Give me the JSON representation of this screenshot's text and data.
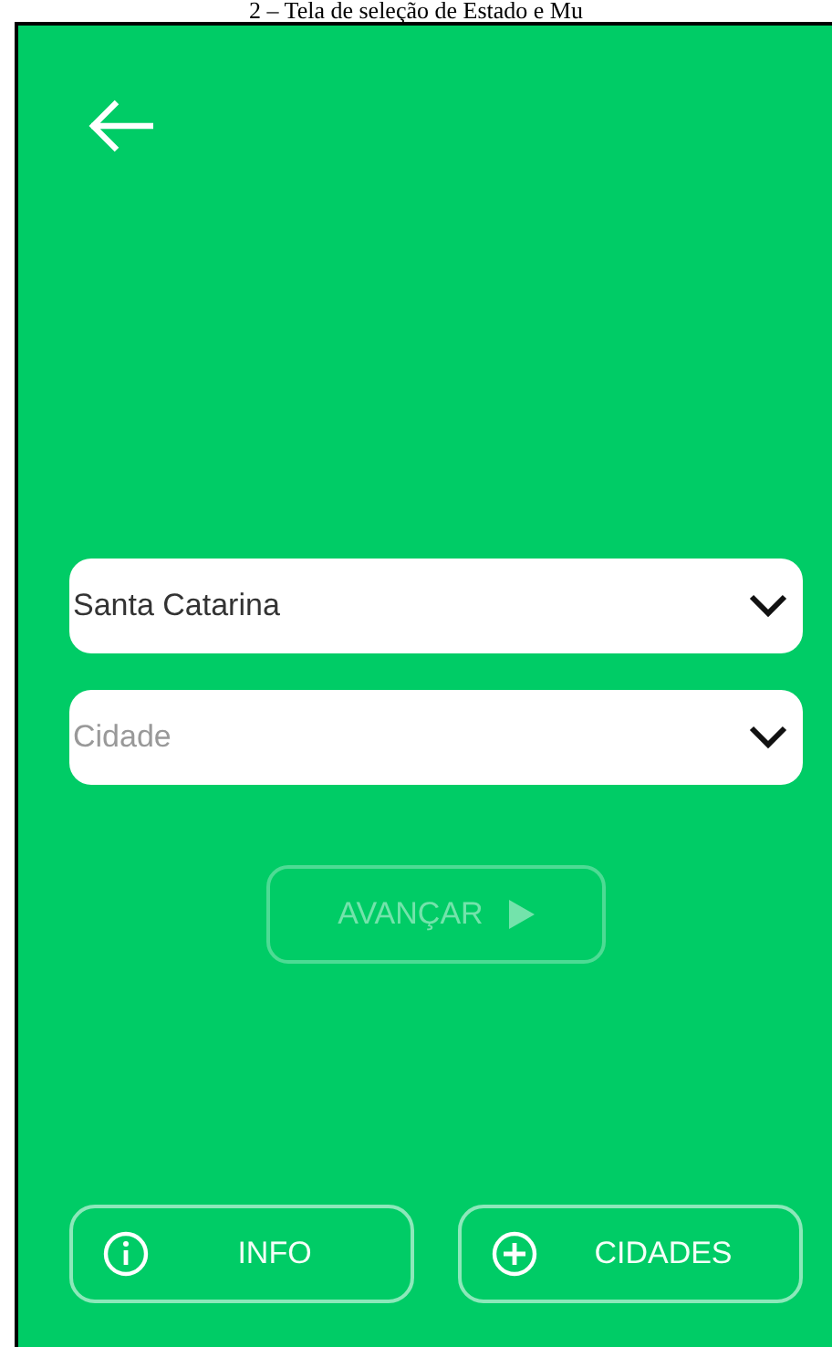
{
  "caption": "2 – Tela de seleção de Estado e Mu",
  "dropdowns": [
    {
      "value": "Santa Catarina"
    },
    {
      "placeholder": "Cidade"
    }
  ],
  "next_button": {
    "label": "AVANÇAR",
    "disabled": true
  },
  "bottom_buttons": [
    {
      "label": "INFO",
      "kind": "info"
    },
    {
      "label": "CIDADES",
      "kind": "add"
    }
  ]
}
